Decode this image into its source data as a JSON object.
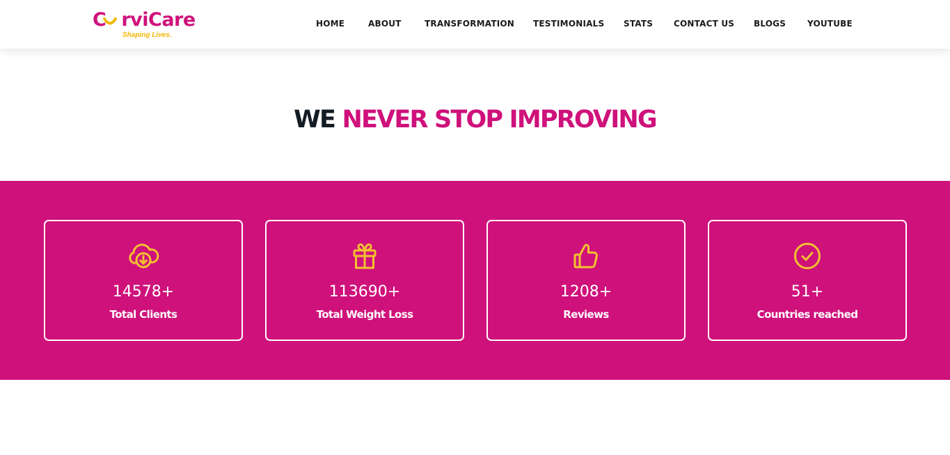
{
  "brand": {
    "logo_text_a": "C",
    "logo_text_b": "rviCare",
    "tagline": "Shaping Lives.",
    "primary_color": "#cf117b",
    "accent_color": "#f2c230"
  },
  "nav": {
    "items": [
      "HOME",
      "ABOUT",
      "TRANSFORMATION",
      "TESTIMONIALS",
      "STATS",
      "CONTACT US",
      "BLOGS",
      "YOUTUBE"
    ]
  },
  "section": {
    "heading_dark": "WE",
    "heading_pink": "NEVER STOP IMPROVING"
  },
  "stats": [
    {
      "icon": "cloud-download-icon",
      "value": "14578+",
      "label": "Total Clients"
    },
    {
      "icon": "gift-icon",
      "value": "113690+",
      "label": "Total Weight Loss"
    },
    {
      "icon": "thumbs-up-icon",
      "value": "1208+",
      "label": "Reviews"
    },
    {
      "icon": "check-circle-icon",
      "value": "51+",
      "label": "Countries reached"
    }
  ]
}
